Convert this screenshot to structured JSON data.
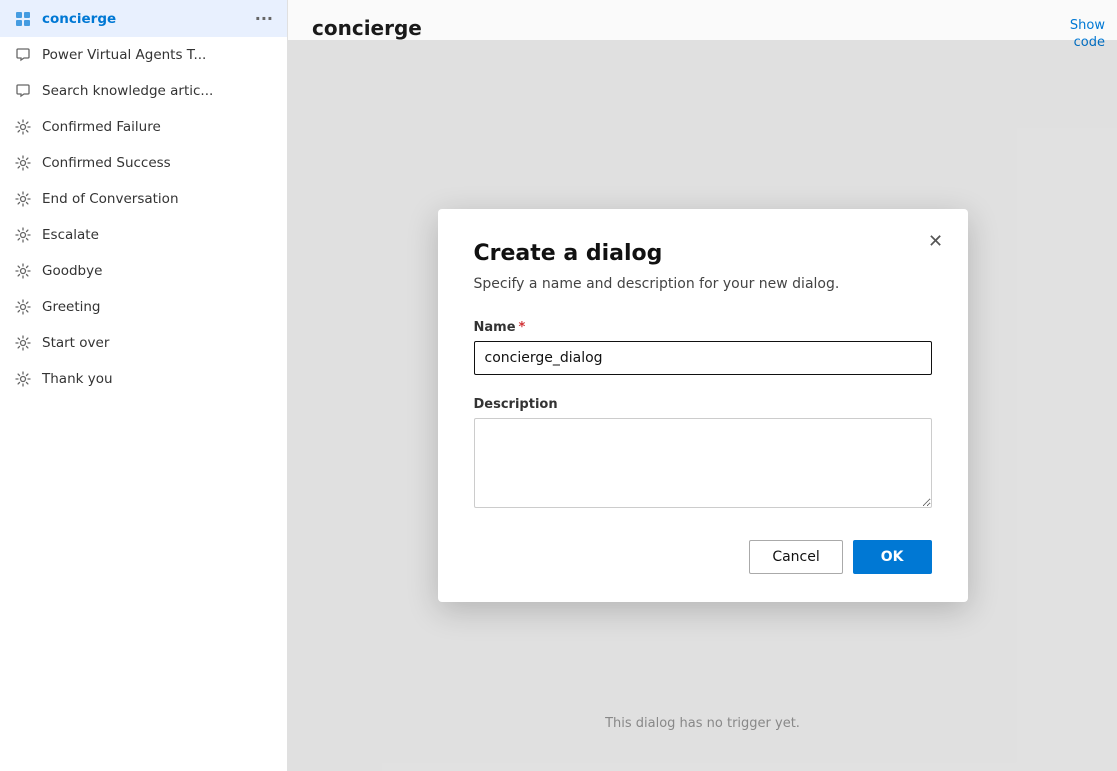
{
  "sidebar": {
    "items": [
      {
        "id": "concierge",
        "label": "concierge",
        "icon": "grid-icon",
        "active": true,
        "showMore": true
      },
      {
        "id": "power-virtual",
        "label": "Power Virtual Agents T...",
        "icon": "chat-icon",
        "active": false
      },
      {
        "id": "search-knowledge",
        "label": "Search knowledge artic...",
        "icon": "chat-icon",
        "active": false
      },
      {
        "id": "confirmed-failure",
        "label": "Confirmed Failure",
        "icon": "cog-icon",
        "active": false
      },
      {
        "id": "confirmed-success",
        "label": "Confirmed Success",
        "icon": "cog-icon",
        "active": false
      },
      {
        "id": "end-of-conversation",
        "label": "End of Conversation",
        "icon": "cog-icon",
        "active": false
      },
      {
        "id": "escalate",
        "label": "Escalate",
        "icon": "cog-icon",
        "active": false
      },
      {
        "id": "goodbye",
        "label": "Goodbye",
        "icon": "cog-icon",
        "active": false
      },
      {
        "id": "greeting",
        "label": "Greeting",
        "icon": "cog-icon",
        "active": false
      },
      {
        "id": "start-over",
        "label": "Start over",
        "icon": "cog-icon",
        "active": false
      },
      {
        "id": "thank-you",
        "label": "Thank you",
        "icon": "cog-icon",
        "active": false
      }
    ]
  },
  "main": {
    "title": "concierge",
    "show_code_label": "Show\ncode",
    "bottom_hint": "This dialog has no trigger yet."
  },
  "modal": {
    "title": "Create a dialog",
    "subtitle": "Specify a name and description for your new dialog.",
    "name_label": "Name",
    "name_required": "*",
    "name_value": "concierge_dialog",
    "description_label": "Description",
    "description_value": "",
    "cancel_label": "Cancel",
    "ok_label": "OK"
  },
  "colors": {
    "accent": "#0078d4",
    "required": "#d13438"
  }
}
